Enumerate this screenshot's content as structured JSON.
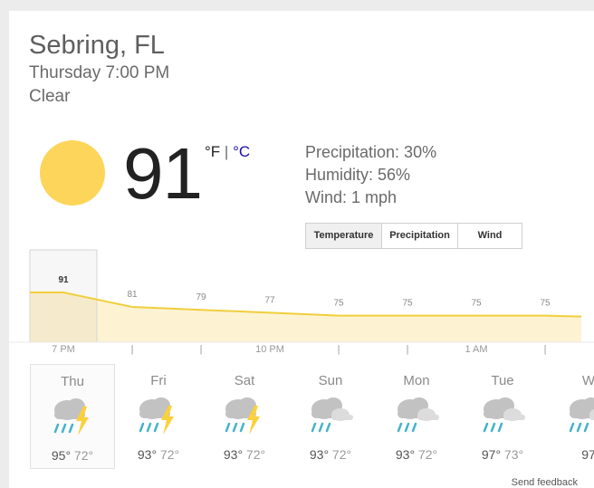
{
  "location": "Sebring, FL",
  "datetime": "Thursday 7:00 PM",
  "condition": "Clear",
  "current": {
    "temperature": "91",
    "unit_f": "°F",
    "unit_sep": " | ",
    "unit_c": "°C",
    "precipitation": "Precipitation: 30%",
    "humidity": "Humidity: 56%",
    "wind": "Wind: 1 mph"
  },
  "tabs": [
    "Temperature",
    "Precipitation",
    "Wind"
  ],
  "active_tab": "Temperature",
  "hourly": {
    "values": [
      91,
      81,
      79,
      77,
      75,
      75,
      75,
      75
    ],
    "labels": [
      "91",
      "81",
      "79",
      "77",
      "75",
      "75",
      "75",
      "75"
    ],
    "time_labels": [
      "7 PM",
      "|",
      "|",
      "10 PM",
      "|",
      "|",
      "1 AM",
      "|"
    ]
  },
  "days": [
    {
      "name": "Thu",
      "hi": "95°",
      "lo": "72°",
      "icon": "thunderstorm-icon"
    },
    {
      "name": "Fri",
      "hi": "93°",
      "lo": "72°",
      "icon": "thunderstorm-icon"
    },
    {
      "name": "Sat",
      "hi": "93°",
      "lo": "72°",
      "icon": "thunderstorm-icon"
    },
    {
      "name": "Sun",
      "hi": "93°",
      "lo": "72°",
      "icon": "rain-cloud-icon"
    },
    {
      "name": "Mon",
      "hi": "93°",
      "lo": "72°",
      "icon": "rain-cloud-icon"
    },
    {
      "name": "Tue",
      "hi": "97°",
      "lo": "73°",
      "icon": "rain-cloud-icon"
    },
    {
      "name": "W",
      "hi": "97",
      "lo": "",
      "icon": "rain-cloud-icon"
    }
  ],
  "feedback": "Send feedback",
  "colors": {
    "sun": "#fcd55a",
    "line": "#f1ce3c",
    "fill": "#fdf3d3",
    "rain": "#46b3c9",
    "bolt": "#fcd03a",
    "cloud": "#c9c9c9"
  }
}
